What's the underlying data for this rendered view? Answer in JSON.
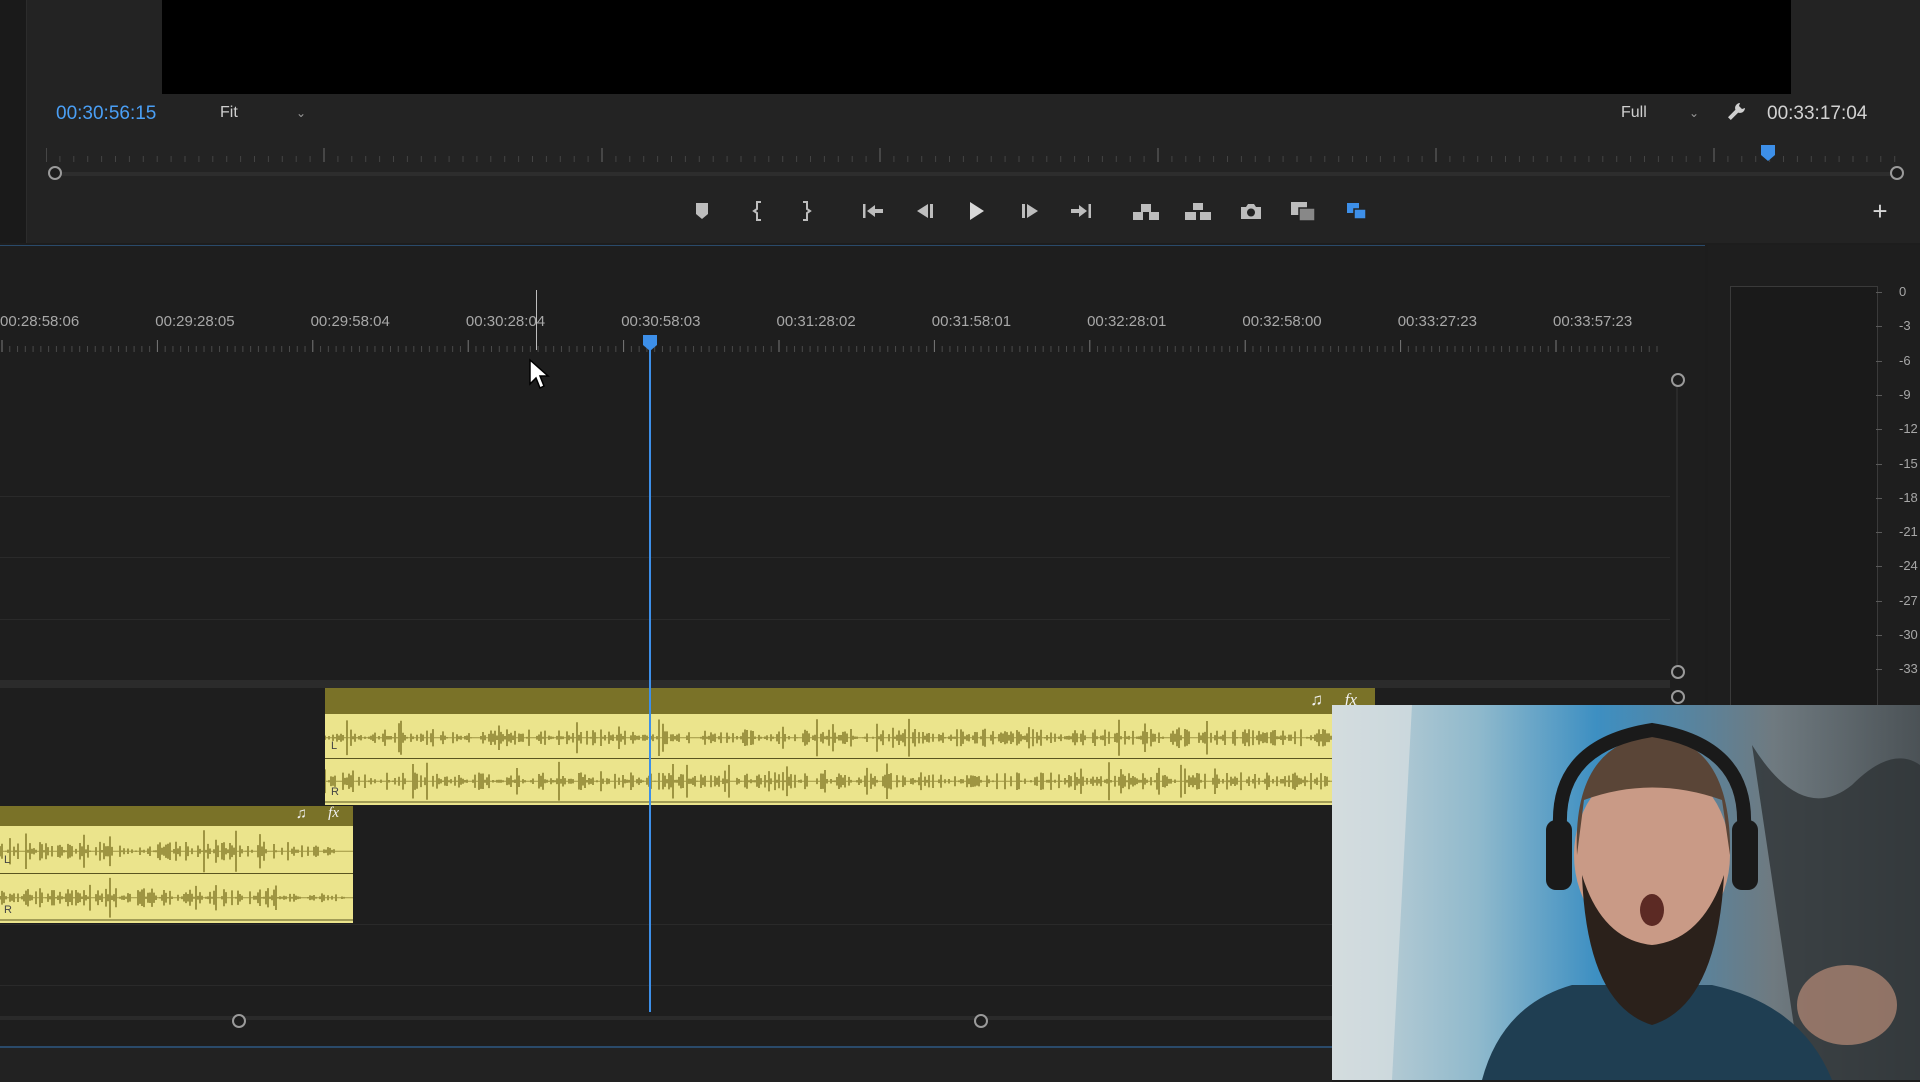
{
  "monitor": {
    "current_timecode": "00:30:56:15",
    "duration_timecode": "00:33:17:04",
    "zoom_select": "Fit",
    "quality_select": "Full"
  },
  "transport_controls": [
    {
      "name": "add-marker-button",
      "icon": "marker-icon"
    },
    {
      "name": "mark-in-button",
      "icon": "mark-in-icon"
    },
    {
      "name": "mark-out-button",
      "icon": "mark-out-icon"
    },
    {
      "name": "go-to-in-button",
      "icon": "go-to-in-icon"
    },
    {
      "name": "step-back-button",
      "icon": "step-back-icon"
    },
    {
      "name": "play-button",
      "icon": "play-icon"
    },
    {
      "name": "step-forward-button",
      "icon": "step-forward-icon"
    },
    {
      "name": "go-to-out-button",
      "icon": "go-to-out-icon"
    },
    {
      "name": "lift-button",
      "icon": "lift-icon"
    },
    {
      "name": "extract-button",
      "icon": "extract-icon"
    },
    {
      "name": "export-frame-button",
      "icon": "camera-icon"
    },
    {
      "name": "comparison-view-button",
      "icon": "comparison-icon"
    },
    {
      "name": "proxy-toggle-button",
      "icon": "proxy-icon"
    }
  ],
  "timeline": {
    "ruler_labels": [
      "00:28:58:06",
      "00:29:28:05",
      "00:29:58:04",
      "00:30:28:04",
      "00:30:58:03",
      "00:31:28:02",
      "00:31:58:01",
      "00:32:28:01",
      "00:32:58:00",
      "00:33:27:23",
      "00:33:57:23"
    ],
    "clips": [
      {
        "name": "audio-clip-a1",
        "channel_top": "L",
        "channel_bottom": "R"
      },
      {
        "name": "audio-clip-a2",
        "channel_top": "L",
        "channel_bottom": "R"
      }
    ]
  },
  "audio_meter": {
    "db_labels": [
      "0",
      "-3",
      "-6",
      "-9",
      "-12",
      "-15",
      "-18",
      "-21",
      "-24",
      "-27",
      "-30",
      "-33"
    ]
  },
  "colors": {
    "accent": "#3d8fe8",
    "audio_clip": "#ebe48c",
    "audio_clip_header": "#7a7228",
    "waveform": "#7d7322"
  }
}
